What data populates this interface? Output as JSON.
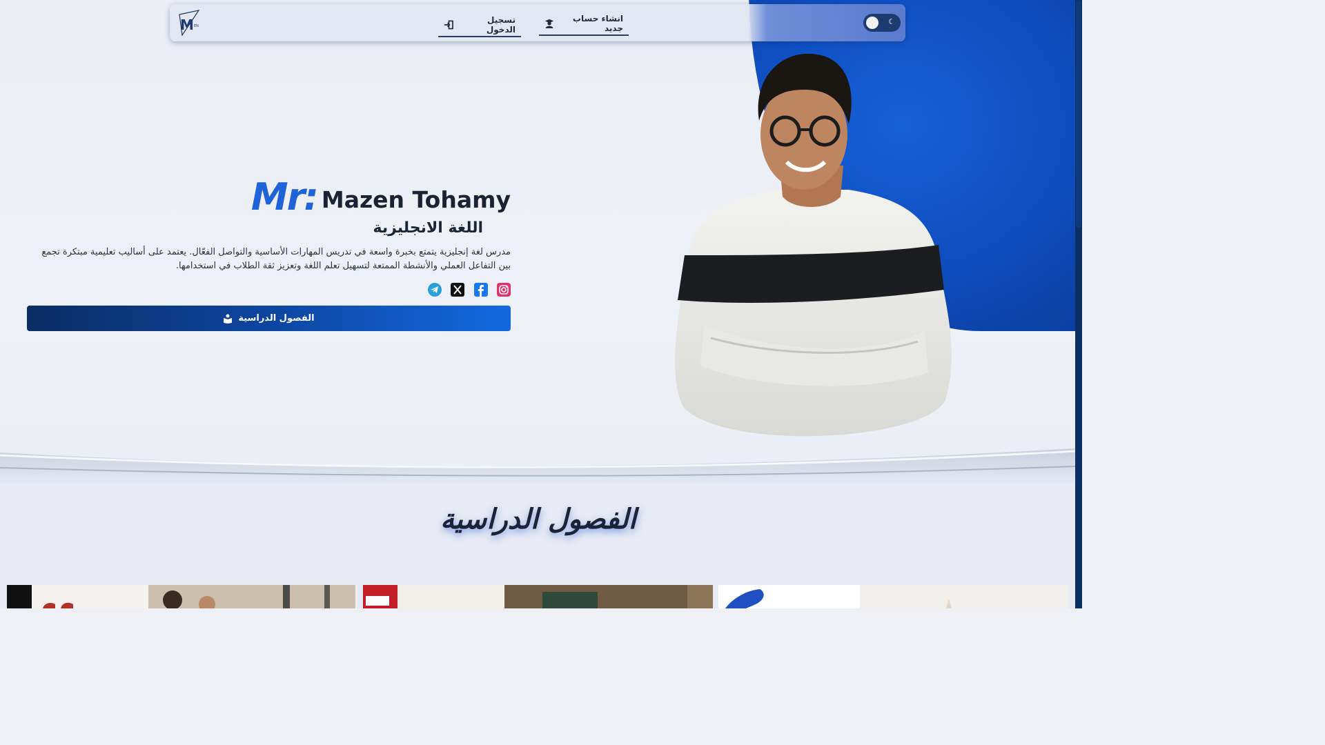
{
  "nav": {
    "signup_label": "انشاء حساب جديد",
    "login_label": "تسجيل الدخول",
    "logo_text": "M"
  },
  "hero": {
    "prefix": "Mr:",
    "name": "Mazen Tohamy",
    "subject": "اللغة الانجليزية",
    "description": "مدرس لغة إنجليزية يتمتع بخبرة واسعة في تدريس المهارات الأساسية والتواصل الفعّال. يعتمد على أساليب تعليمية مبتكرة تجمع بين التفاعل العملي والأنشطة الممتعة لتسهيل تعلم اللغة وتعزيز ثقة الطلاب في استخدامها.",
    "cta_label": "الفصول الدراسية",
    "socials": [
      "telegram-icon",
      "x-icon",
      "facebook-icon",
      "instagram-icon"
    ]
  },
  "section": {
    "title": "الفصول الدراسية"
  },
  "colors": {
    "accent": "#1f63d9",
    "navy": "#0a2d63",
    "text": "#1a2233"
  }
}
